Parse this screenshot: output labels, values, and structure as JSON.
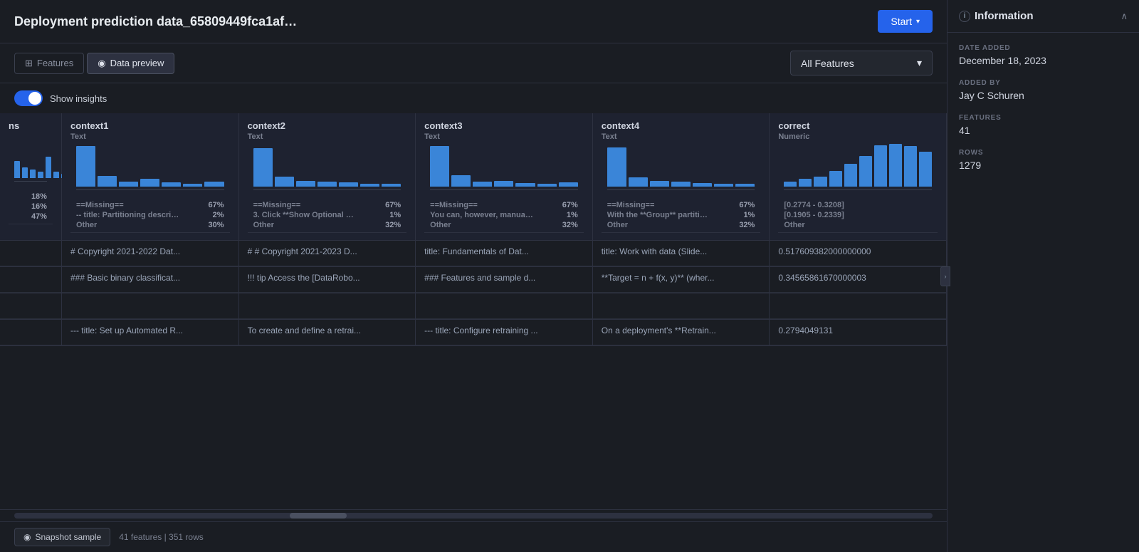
{
  "header": {
    "title": "Deployment prediction data_65809449fca1af…",
    "start_button": "Start"
  },
  "toolbar": {
    "tabs": [
      {
        "label": "Features",
        "active": false,
        "icon": "grid-icon"
      },
      {
        "label": "Data preview",
        "active": true,
        "icon": "eye-icon"
      }
    ],
    "dropdown_label": "All Features"
  },
  "insights": {
    "toggle_on": true,
    "label": "Show insights"
  },
  "columns": [
    {
      "name": "ns",
      "type": ""
    },
    {
      "name": "context1",
      "type": "Text"
    },
    {
      "name": "context2",
      "type": "Text"
    },
    {
      "name": "context3",
      "type": "Text"
    },
    {
      "name": "context4",
      "type": "Text"
    },
    {
      "name": "correct",
      "type": "Numeric"
    }
  ],
  "charts": {
    "ns": [
      30,
      20,
      15,
      10,
      35,
      10,
      5
    ],
    "context1": [
      80,
      20,
      10,
      15,
      8,
      5,
      10
    ],
    "context2": [
      75,
      20,
      12,
      10,
      8,
      6,
      5
    ],
    "context3": [
      80,
      22,
      10,
      12,
      7,
      5,
      8
    ],
    "context4": [
      78,
      18,
      12,
      10,
      7,
      5,
      6
    ],
    "correct": [
      10,
      15,
      20,
      30,
      45,
      60,
      80,
      90,
      85,
      70
    ]
  },
  "stats": {
    "ns": [
      {
        "label": "",
        "value": "18%"
      },
      {
        "label": "",
        "value": "16%"
      },
      {
        "label": "",
        "value": "47%"
      }
    ],
    "context1": [
      {
        "label": "==Missing==",
        "value": "67%"
      },
      {
        "label": "-- title: Partitioning descriptio...",
        "value": "2%"
      },
      {
        "label": "Other",
        "value": "30%"
      }
    ],
    "context2": [
      {
        "label": "==Missing==",
        "value": "67%"
      },
      {
        "label": "3. Click **Show Optional Field...",
        "value": "1%"
      },
      {
        "label": "Other",
        "value": "32%"
      }
    ],
    "context3": [
      {
        "label": "==Missing==",
        "value": "67%"
      },
      {
        "label": "You can, however, manually re...",
        "value": "1%"
      },
      {
        "label": "Other",
        "value": "32%"
      }
    ],
    "context4": [
      {
        "label": "==Missing==",
        "value": "67%"
      },
      {
        "label": "With the **Group** partitionin...",
        "value": "1%"
      },
      {
        "label": "Other",
        "value": "32%"
      }
    ],
    "correct": [
      {
        "label": "[0.2774 - 0.3208]",
        "value": ""
      },
      {
        "label": "[0.1905 - 0.2339]",
        "value": ""
      },
      {
        "label": "Other",
        "value": ""
      }
    ]
  },
  "rows": [
    {
      "ns": "",
      "context1": "# Copyright 2021-2022 Dat...",
      "context2": "# # Copyright 2021-2023 D...",
      "context3": "title: Fundamentals of Dat...",
      "context4": "title: Work with data (Slide...",
      "correct": "0.517609382000000000"
    },
    {
      "ns": "",
      "context1": "### Basic binary classificat...",
      "context2": "!!! tip Access the [DataRobo...",
      "context3": "### Features and sample d...",
      "context4": "**Target = n + f(x, y)** (wher...",
      "correct": "0.34565861670000003"
    },
    {
      "ns": "",
      "context1": "",
      "context2": "",
      "context3": "",
      "context4": "",
      "correct": ""
    },
    {
      "ns": "",
      "context1": "--- title: Set up Automated R...",
      "context2": "To create and define a retrai...",
      "context3": "--- title: Configure retraining ...",
      "context4": "On a deployment's **Retrain...",
      "correct": "0.2794049131"
    }
  ],
  "sidebar": {
    "title": "Information",
    "date_added_label": "DATE ADDED",
    "date_added_value": "December 18, 2023",
    "added_by_label": "ADDED BY",
    "added_by_value": "Jay C Schuren",
    "features_label": "FEATURES",
    "features_value": "41",
    "rows_label": "ROWS",
    "rows_value": "1279"
  },
  "footer": {
    "snapshot_label": "Snapshot sample",
    "stats": "41 features  |  351 rows"
  }
}
